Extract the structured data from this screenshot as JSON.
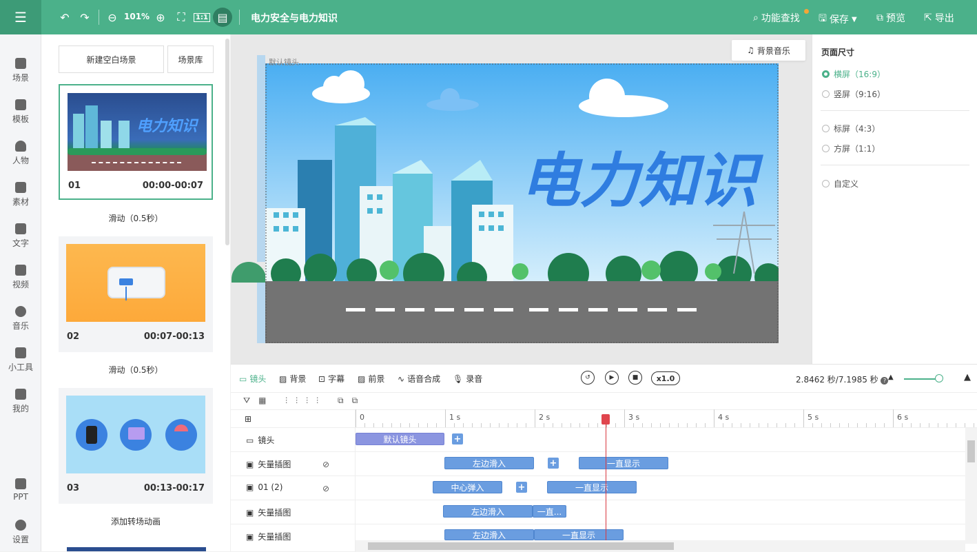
{
  "topbar": {
    "zoom": "101%",
    "project_title": "电力安全与电力知识",
    "feature_search": "功能查找",
    "save": "保存",
    "preview": "预览",
    "export": "导出"
  },
  "sidebar": [
    {
      "label": "场景",
      "icon": "scene-icon"
    },
    {
      "label": "模板",
      "icon": "template-icon"
    },
    {
      "label": "人物",
      "icon": "person-icon"
    },
    {
      "label": "素材",
      "icon": "material-icon"
    },
    {
      "label": "文字",
      "icon": "text-icon"
    },
    {
      "label": "视频",
      "icon": "video-icon"
    },
    {
      "label": "音乐",
      "icon": "music-icon"
    },
    {
      "label": "小工具",
      "icon": "toolbox-icon"
    },
    {
      "label": "我的",
      "icon": "upload-icon"
    },
    {
      "label": "PPT",
      "icon": "ppt-icon"
    },
    {
      "label": "设置",
      "icon": "gear-icon"
    }
  ],
  "scenes_panel": {
    "new_scene": "新建空白场景",
    "library": "场景库",
    "cards": [
      {
        "num": "01",
        "time": "00:00-00:07",
        "transition": "滑动（0.5秒）",
        "thumb_title": "电力知识"
      },
      {
        "num": "02",
        "time": "00:07-00:13",
        "transition": "滑动（0.5秒）"
      },
      {
        "num": "03",
        "time": "00:13-00:17",
        "transition": "添加转场动画"
      }
    ]
  },
  "canvas": {
    "bg_music": "背景音乐",
    "corner_label": "默认镜头",
    "headline": "电力知识"
  },
  "page_size": {
    "title": "页面尺寸",
    "options": [
      {
        "label": "横屏（16:9）",
        "selected": true
      },
      {
        "label": "竖屏（9:16）",
        "selected": false
      },
      {
        "label": "标屏（4:3）",
        "selected": false
      },
      {
        "label": "方屏（1:1）",
        "selected": false
      },
      {
        "label": "自定义",
        "selected": false
      }
    ]
  },
  "timeline": {
    "tabs": [
      "镜头",
      "背景",
      "字幕",
      "前景",
      "语音合成",
      "录音"
    ],
    "speed": "x1.0",
    "time_info": "2.8462 秒/7.1985 秒",
    "ruler": [
      "0",
      "1 s",
      "2 s",
      "3 s",
      "4 s",
      "5 s",
      "6 s"
    ],
    "tracks": [
      {
        "label": "镜头",
        "blocks": [
          "默认镜头"
        ]
      },
      {
        "label": "矢量插图",
        "blocks": [
          "左边滑入",
          "一直显示"
        ]
      },
      {
        "label": "01 (2)",
        "blocks": [
          "中心弹入",
          "一直显示"
        ]
      },
      {
        "label": "矢量插图",
        "blocks": [
          "左边滑入",
          "一直..."
        ]
      },
      {
        "label": "矢量插图",
        "blocks": [
          "左边滑入",
          "一直显示"
        ]
      }
    ],
    "playhead_seconds": 2.8462,
    "total_seconds": 7.1985
  }
}
